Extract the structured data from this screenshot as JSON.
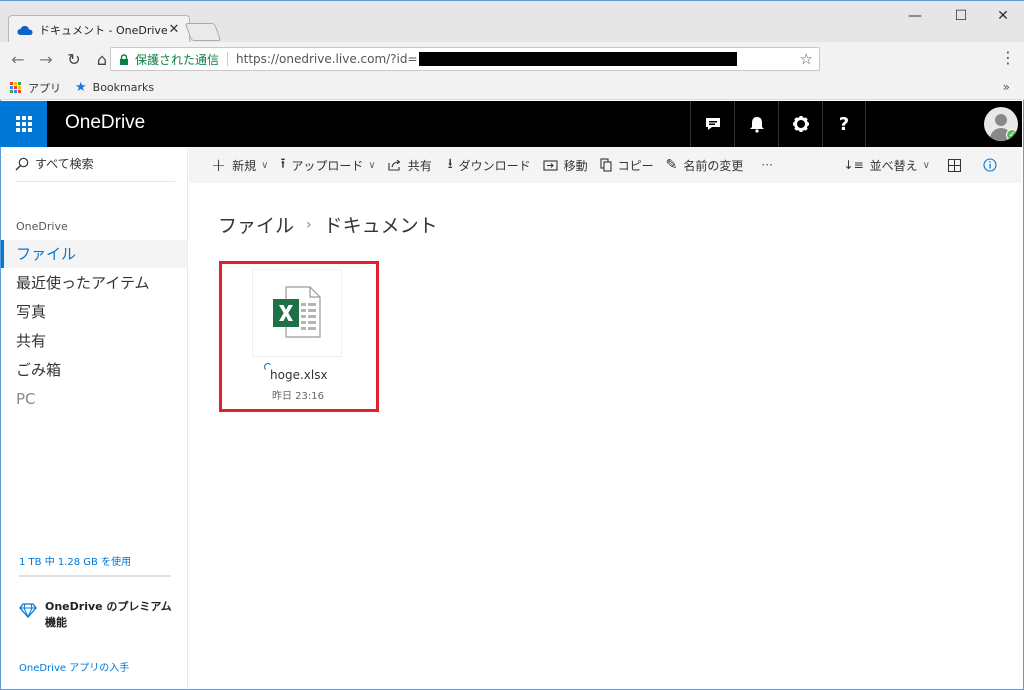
{
  "browser": {
    "tab_title": "ドキュメント - OneDrive",
    "secure_label": "保護された通信",
    "url": "https://onedrive.live.com/?id=",
    "bookmarks": {
      "apps_label": "アプリ",
      "bookmarks_label": "Bookmarks"
    }
  },
  "suite": {
    "brand": "OneDrive"
  },
  "leftnav": {
    "search_label": "すべて検索",
    "section_header": "OneDrive",
    "items": [
      {
        "label": "ファイル"
      },
      {
        "label": "最近使ったアイテム"
      },
      {
        "label": "写真"
      },
      {
        "label": "共有"
      },
      {
        "label": "ごみ箱"
      },
      {
        "label": "PC"
      }
    ],
    "quota_text": "1 TB 中 1.28 GB を使用",
    "premium_line1": "OneDrive のプレミアム",
    "premium_line2": "機能",
    "get_apps": "OneDrive アプリの入手"
  },
  "commands": {
    "new": "新規",
    "upload": "アップロード",
    "share": "共有",
    "download": "ダウンロード",
    "move": "移動",
    "copy": "コピー",
    "rename": "名前の変更",
    "more": "···",
    "sort": "並べ替え"
  },
  "breadcrumb": {
    "root": "ファイル",
    "current": "ドキュメント"
  },
  "file": {
    "name": "hoge.xlsx",
    "modified": "昨日 23:16"
  },
  "colors": {
    "accent": "#0078d7",
    "highlight": "#e0202a",
    "excel_green": "#1e7145"
  }
}
